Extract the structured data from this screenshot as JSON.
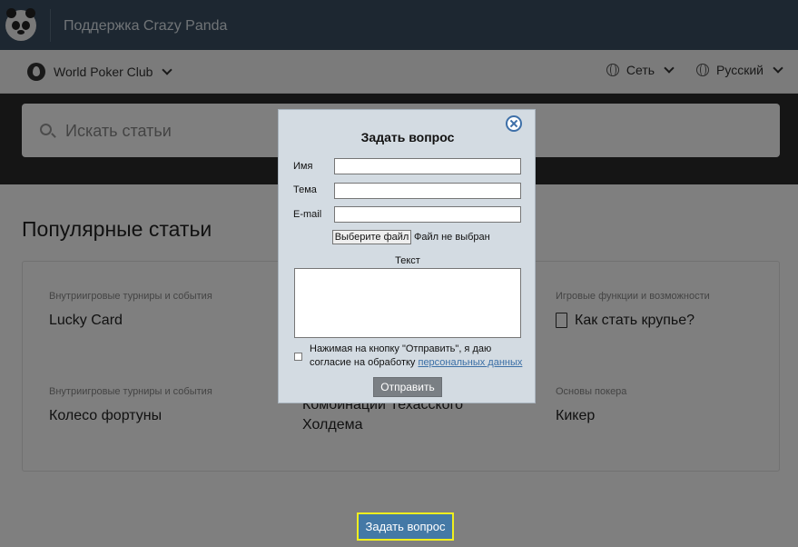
{
  "header": {
    "brand": "Поддержка Crazy Panda",
    "logo_icon": "panda-logo-icon"
  },
  "subnav": {
    "product": "World Poker Club",
    "network": "Сеть",
    "language": "Русский"
  },
  "search": {
    "placeholder": "Искать статьи"
  },
  "popular": {
    "title": "Популярные статьи",
    "cards": [
      {
        "category": "Внутриигровые турниры и события",
        "title": "Lucky Card"
      },
      {
        "category": "Игровые функции и возможности",
        "title": "Как стать крупье?"
      },
      {
        "category": "Внутриигровые турниры и события",
        "title": "Колесо фортуны"
      },
      {
        "category": "",
        "title": "Комбинации Техасского Холдема"
      },
      {
        "category": "Основы покера",
        "title": "Кикер"
      }
    ]
  },
  "ask_button": "Задать вопрос",
  "modal": {
    "title": "Задать вопрос",
    "name_label": "Имя",
    "subject_label": "Тема",
    "email_label": "E-mail",
    "file_button": "Выберите файл",
    "file_status": "Файл не выбран",
    "text_label": "Текст",
    "consent_text": "Нажимая на кнопку \"Отправить\", я даю согласие на обработку",
    "consent_link": "персональных данных",
    "submit": "Отправить"
  },
  "colors": {
    "topbar": "#3a4f63",
    "accent_button": "#4479a6",
    "highlight_border": "#f0ee1e",
    "modal_bg": "#d3dbe2"
  }
}
